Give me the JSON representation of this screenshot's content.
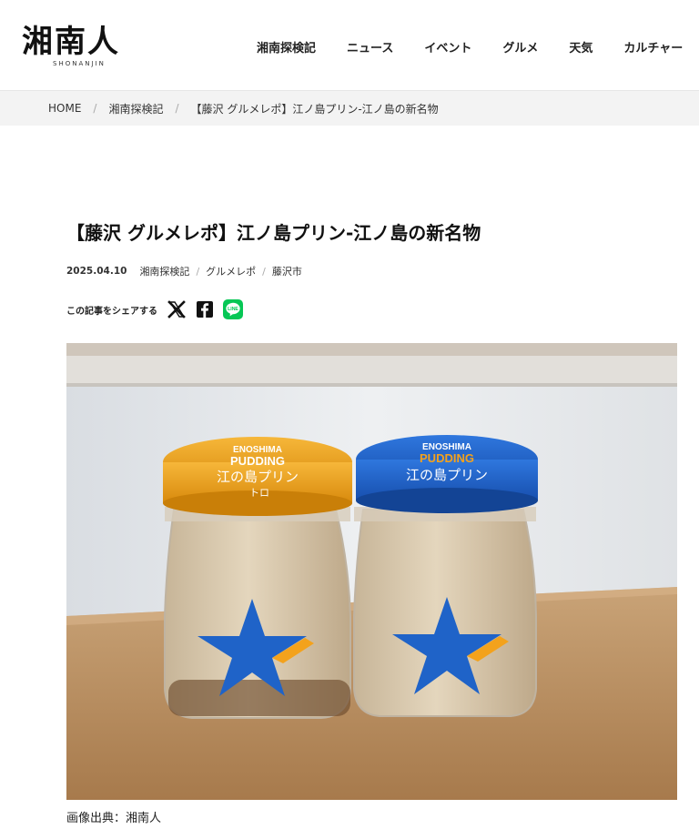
{
  "site": {
    "logo_text": "湘南人",
    "logo_sub": "SHONANJIN"
  },
  "nav": {
    "items": [
      {
        "label": "湘南探検記"
      },
      {
        "label": "ニュース"
      },
      {
        "label": "イベント"
      },
      {
        "label": "グルメ"
      },
      {
        "label": "天気"
      },
      {
        "label": "カルチャー"
      }
    ]
  },
  "breadcrumb": {
    "home": "HOME",
    "category": "湘南探検記",
    "current": "【藤沢 グルメレポ】江ノ島プリン-江ノ島の新名物",
    "separator": "/"
  },
  "article": {
    "title": "【藤沢 グルメレポ】江ノ島プリン-江ノ島の新名物",
    "date": "2025.04.10",
    "categories": [
      "湘南探検記",
      "グルメレポ",
      "藤沢市"
    ],
    "share_label": "この記事をシェアする",
    "share_icons": [
      "x-icon",
      "facebook-icon",
      "line-icon"
    ],
    "image_caption": "画像出典：湘南人",
    "jar_left": {
      "top_text": "ENOSHIMA",
      "mid_text": "PUDDING",
      "label": "江の島プリン",
      "sub": "トロ",
      "lid_color": "#f0a21a"
    },
    "jar_right": {
      "top_text": "ENOSHIMA",
      "mid_text": "PUDDING",
      "label": "江の島プリン",
      "lid_color": "#1f63c8"
    }
  },
  "colors": {
    "line_green": "#06c755",
    "star_blue": "#1f63c8",
    "star_accent": "#f3a21c"
  }
}
